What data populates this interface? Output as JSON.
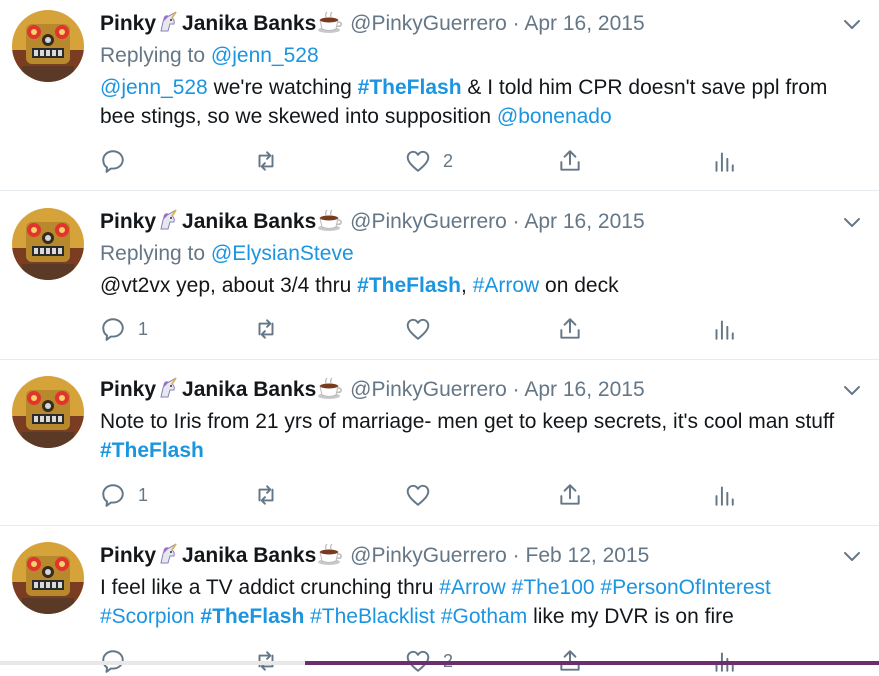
{
  "user": {
    "display_name": "Pinky",
    "display_name_2": "Janika Banks",
    "handle": "@PinkyGuerrero"
  },
  "separator": "·",
  "tweets": [
    {
      "date": "Apr 16, 2015",
      "reply_prefix": "Replying to",
      "reply_to": "@jenn_528",
      "text": {
        "t1": "@jenn_528",
        "t2": " we're watching ",
        "t3": "#TheFlash",
        "t4": " & I told him CPR doesn't save ppl from bee stings, so we skewed into supposition ",
        "t5": "@bonenado"
      },
      "reply_count": "",
      "like_count": "2"
    },
    {
      "date": "Apr 16, 2015",
      "reply_prefix": "Replying to",
      "reply_to": "@ElysianSteve",
      "text": {
        "t1": "@vt2vx yep, about 3/4 thru ",
        "t2": "#TheFlash",
        "t3": ", ",
        "t4": "#Arrow",
        "t5": " on deck"
      },
      "reply_count": "1",
      "like_count": ""
    },
    {
      "date": "Apr 16, 2015",
      "text": {
        "t1": "Note to Iris from 21 yrs of marriage- men get to keep secrets, it's cool man stuff ",
        "t2": "#TheFlash"
      },
      "reply_count": "1",
      "like_count": ""
    },
    {
      "date": "Feb 12, 2015",
      "text": {
        "t1": "I feel like a TV addict crunching thru ",
        "t2": "#Arrow",
        "t3": " ",
        "t4": "#The100",
        "t5": " ",
        "t6": "#PersonOfInterest",
        "t7": " ",
        "t8": "#Scorpion",
        "t9": " ",
        "t10": "#TheFlash",
        "t11": " ",
        "t12": "#TheBlacklist",
        "t13": " ",
        "t14": "#Gotham",
        "t15": " like my DVR is on fire"
      },
      "reply_count": "",
      "like_count": "2"
    }
  ],
  "icons": {
    "avatar": "robot-avatar",
    "unicorn": "unicorn-emoji",
    "coffee": "hot-beverage-emoji",
    "chevron": "chevron-down-icon",
    "reply": "reply-icon",
    "retweet": "retweet-icon",
    "like": "heart-icon",
    "share": "share-icon",
    "analytics": "analytics-icon"
  },
  "colors": {
    "link": "#1b95e0",
    "muted": "#657786",
    "text": "#14171a",
    "divider": "#e6ecf0"
  }
}
